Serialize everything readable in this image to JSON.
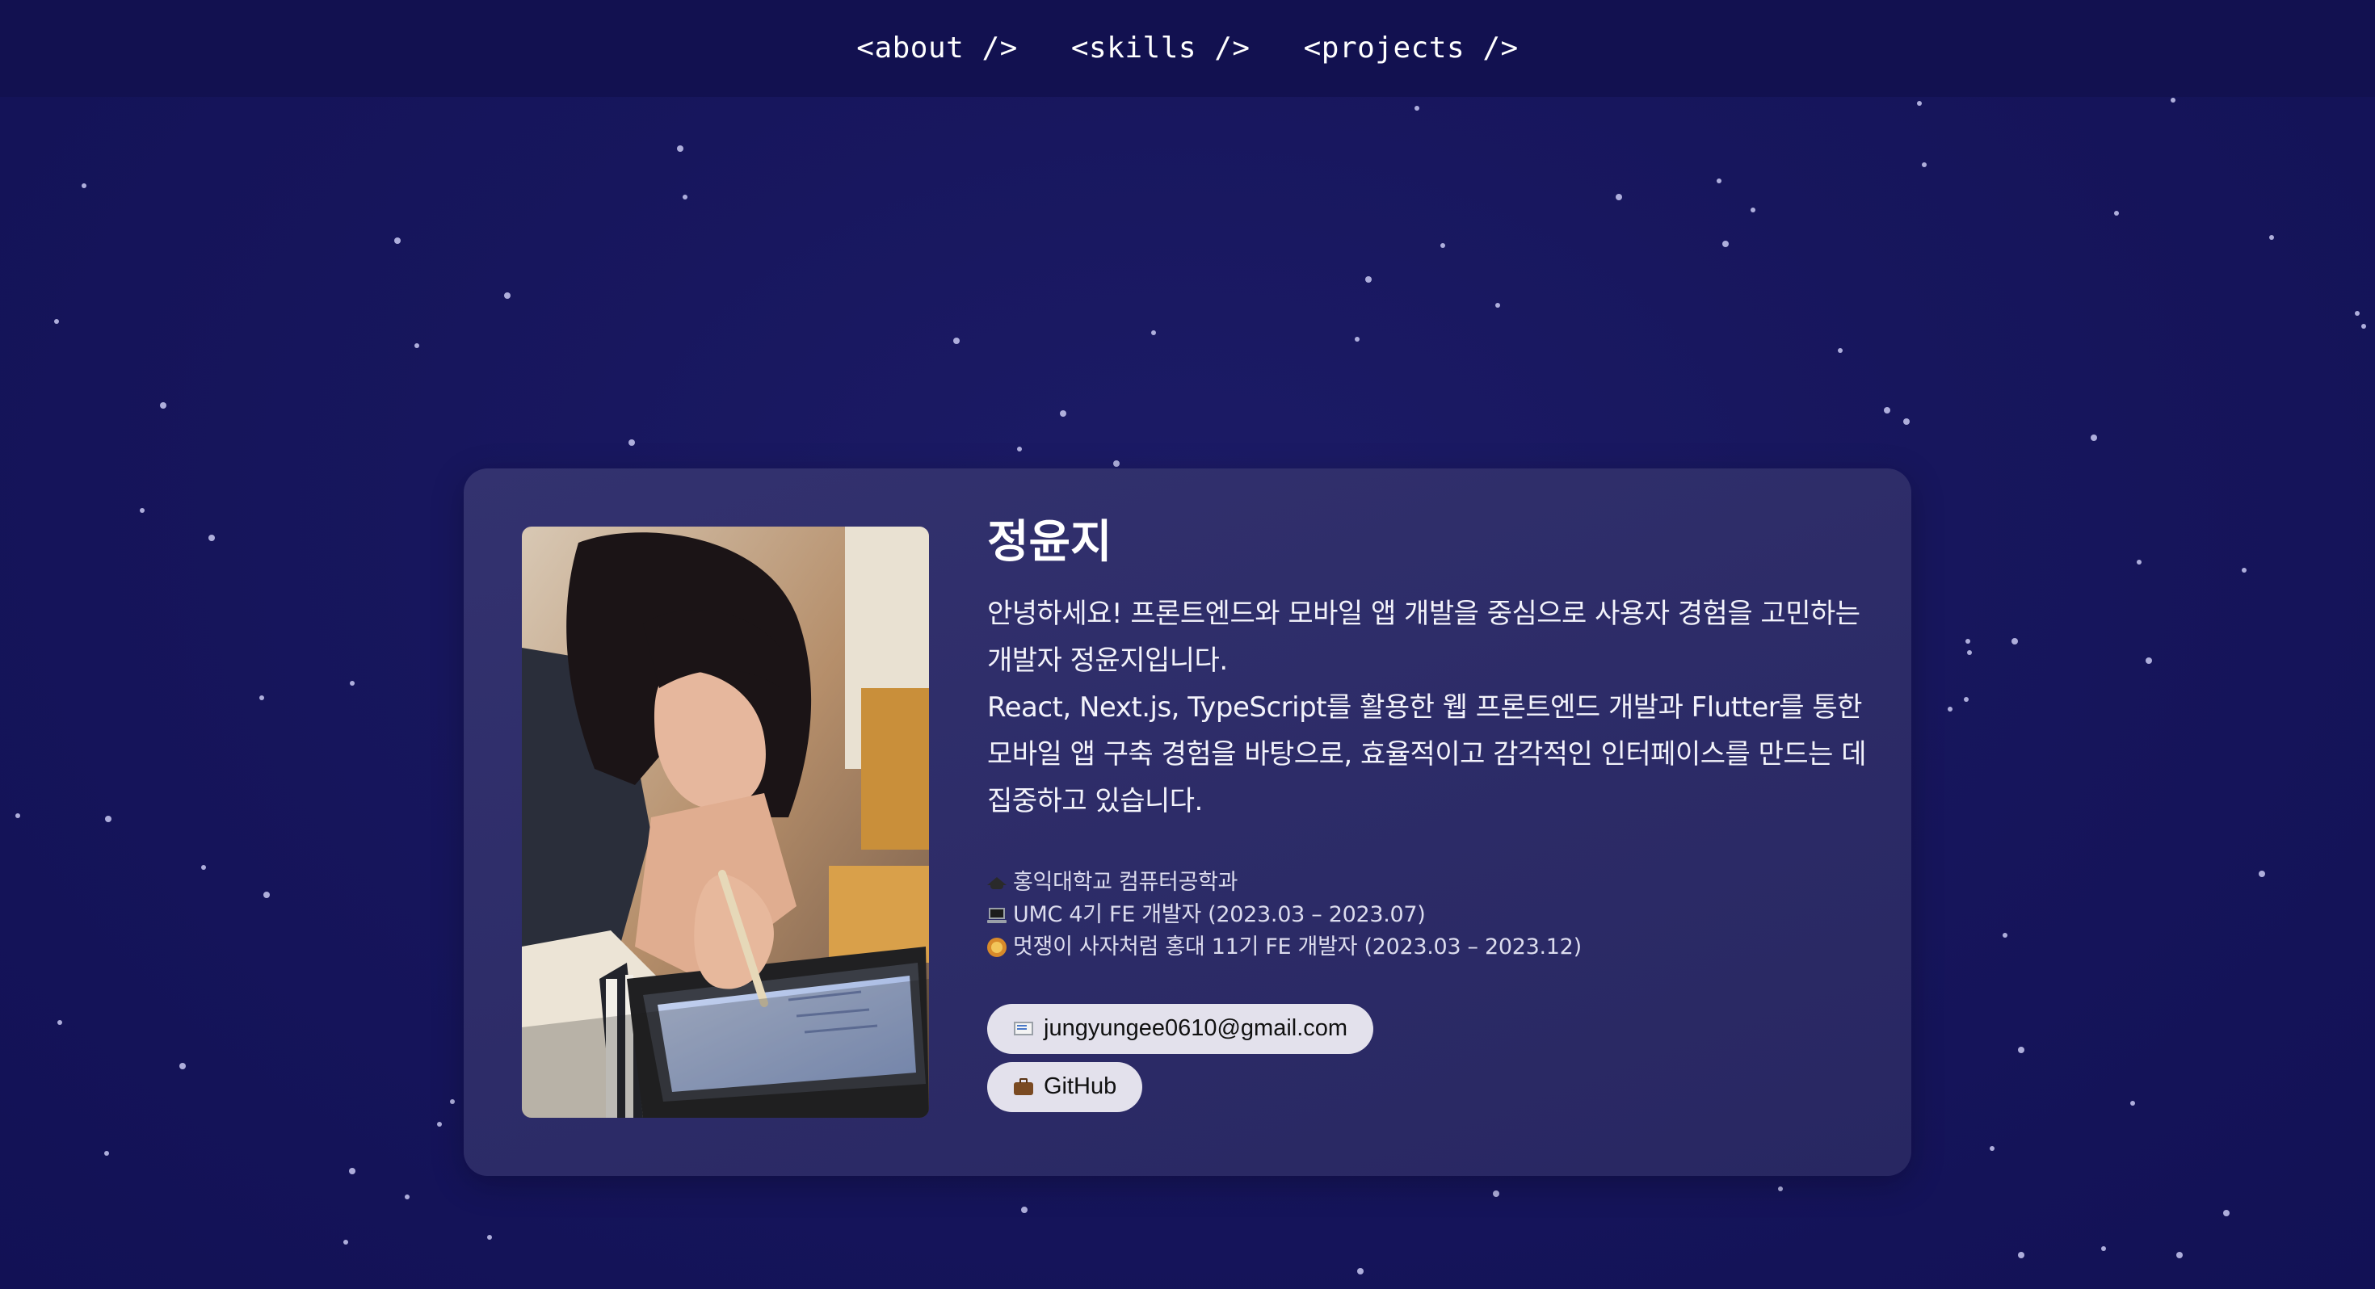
{
  "nav": {
    "items": [
      {
        "label": "<about />"
      },
      {
        "label": "<skills />"
      },
      {
        "label": "<projects />"
      }
    ]
  },
  "profile": {
    "name": "정윤지",
    "intro_line1": "안녕하세요! 프론트엔드와 모바일 앱 개발을 중심으로 사용자 경험을 고민하는 개발자 정윤지입니다.",
    "intro_line2": "React, Next.js, TypeScript를 활용한 웹 프론트엔드 개발과 Flutter를 통한 모바일 앱 구축 경험을 바탕으로, 효율적이고 감각적인 인터페이스를 만드는 데 집중하고 있습니다.",
    "details": [
      {
        "icon": "graduation-cap-icon",
        "text": "홍익대학교 컴퓨터공학과"
      },
      {
        "icon": "laptop-icon",
        "text": "UMC 4기 FE 개발자 (2023.03 – 2023.07)"
      },
      {
        "icon": "lion-icon",
        "text": "멋쟁이 사자처럼 홍대 11기 FE 개발자 (2023.03 – 2023.12)"
      }
    ],
    "links": {
      "email": {
        "icon": "envelope-icon",
        "label": "jungyungee0610@gmail.com"
      },
      "github": {
        "icon": "briefcase-icon",
        "label": "GitHub"
      }
    },
    "photo": {
      "alt": "profile photo"
    }
  },
  "colors": {
    "background": "#15145a",
    "nav_background": "#121150",
    "card_background": "#2f2e6b",
    "pill_background": "#e3e1ec",
    "star": "#c9c9f2"
  }
}
